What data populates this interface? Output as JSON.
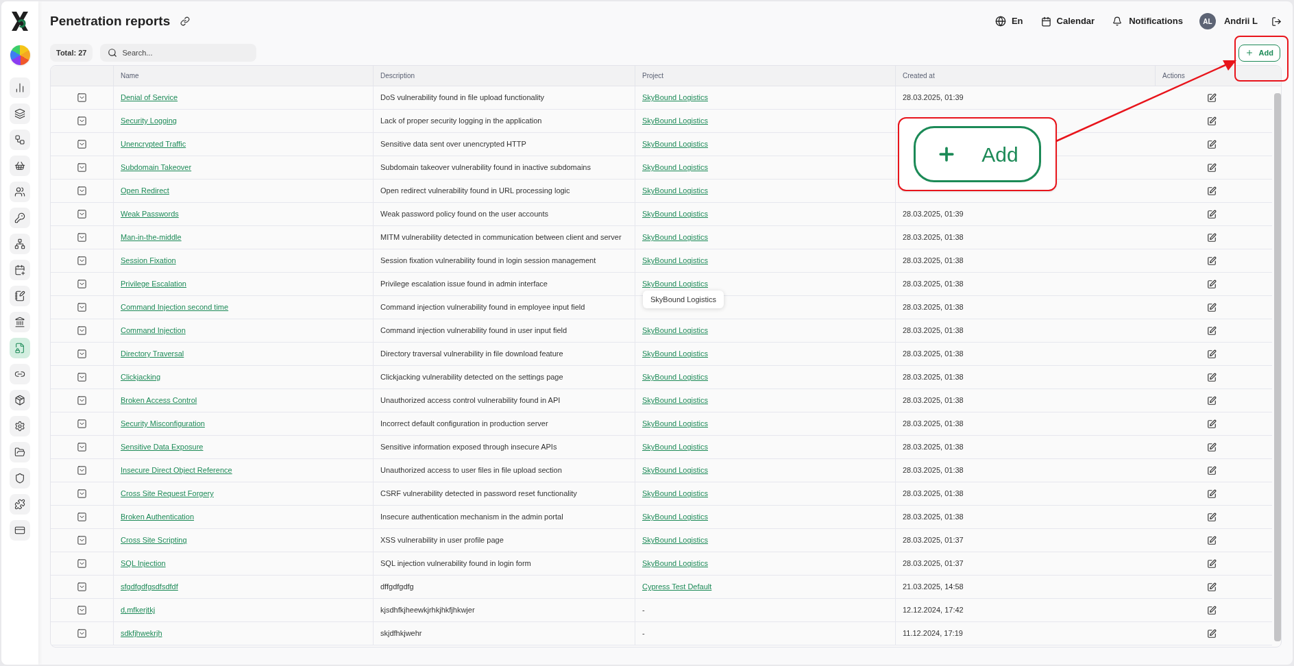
{
  "sidebar": {
    "items": [
      {
        "selected": false
      },
      {
        "selected": false
      },
      {
        "selected": false
      },
      {
        "selected": false
      },
      {
        "selected": false
      },
      {
        "selected": false
      },
      {
        "selected": false
      },
      {
        "selected": false
      },
      {
        "selected": false
      },
      {
        "selected": false
      },
      {
        "selected": true
      },
      {
        "selected": false
      },
      {
        "selected": false
      },
      {
        "selected": false
      },
      {
        "selected": false
      },
      {
        "selected": false
      },
      {
        "selected": false
      },
      {
        "selected": false
      }
    ]
  },
  "header": {
    "title": "Penetration reports",
    "language": "En",
    "calendar": "Calendar",
    "notifications": "Notifications",
    "avatar": "AL",
    "user": "Andrii L"
  },
  "toolbar": {
    "total": "Total: 27",
    "search": {
      "placeholder": "Search..."
    },
    "add_button": "Add"
  },
  "table": {
    "columns": [
      "Name",
      "Description",
      "Project",
      "Created at",
      "Actions"
    ],
    "rows": [
      {
        "name": "Denial of Service",
        "description": "DoS vulnerability found in file upload functionality",
        "project": "SkyBound Logistics",
        "created_at": "28.03.2025, 01:39"
      },
      {
        "name": "Security Logging",
        "description": "Lack of proper security logging in the application",
        "project": "SkyBound Logistics"
      },
      {
        "name": "Unencrypted Traffic",
        "description": "Sensitive data sent over unencrypted HTTP",
        "project": "SkyBound Logistics"
      },
      {
        "name": "Subdomain Takeover",
        "description": "Subdomain takeover vulnerability found in inactive subdomains",
        "project": "SkyBound Logistics"
      },
      {
        "name": "Open Redirect",
        "description": "Open redirect vulnerability found in URL processing logic",
        "project": "SkyBound Logistics"
      },
      {
        "name": "Weak Passwords",
        "description": "Weak password policy found on the user accounts",
        "project": "SkyBound Logistics",
        "created_at": "28.03.2025, 01:39"
      },
      {
        "name": "Man-in-the-middle",
        "description": "MITM vulnerability detected in communication between client and server",
        "project": "SkyBound Logistics",
        "created_at": "28.03.2025, 01:38"
      },
      {
        "name": "Session Fixation",
        "description": "Session fixation vulnerability found in login session management",
        "project": "SkyBound Logistics",
        "created_at": "28.03.2025, 01:38"
      },
      {
        "name": "Privilege Escalation",
        "description": "Privilege escalation issue found in admin interface",
        "project": "SkyBound Logistics",
        "created_at": "28.03.2025, 01:38"
      },
      {
        "name": "Command Injection second time",
        "description": "Command injection vulnerability found in employee input field",
        "tooltip": "SkyBound Logistics",
        "created_at": "28.03.2025, 01:38"
      },
      {
        "name": "Command Injection",
        "description": "Command injection vulnerability found in user input field",
        "project": "SkyBound Logistics",
        "created_at": "28.03.2025, 01:38"
      },
      {
        "name": "Directory Traversal",
        "description": "Directory traversal vulnerability in file download feature",
        "project": "SkyBound Logistics",
        "created_at": "28.03.2025, 01:38"
      },
      {
        "name": "Clickjacking",
        "description": "Clickjacking vulnerability detected on the settings page",
        "project": "SkyBound Logistics",
        "created_at": "28.03.2025, 01:38"
      },
      {
        "name": "Broken Access Control",
        "description": "Unauthorized access control vulnerability found in API",
        "project": "SkyBound Logistics",
        "created_at": "28.03.2025, 01:38"
      },
      {
        "name": "Security Misconfiguration",
        "description": "Incorrect default configuration in production server",
        "project": "SkyBound Logistics",
        "created_at": "28.03.2025, 01:38"
      },
      {
        "name": "Sensitive Data Exposure",
        "description": "Sensitive information exposed through insecure APIs",
        "project": "SkyBound Logistics",
        "created_at": "28.03.2025, 01:38"
      },
      {
        "name": "Insecure Direct Object Reference",
        "description": "Unauthorized access to user files in file upload section",
        "project": "SkyBound Logistics",
        "created_at": "28.03.2025, 01:38"
      },
      {
        "name": "Cross Site Request Forgery",
        "description": "CSRF vulnerability detected in password reset functionality",
        "project": "SkyBound Logistics",
        "created_at": "28.03.2025, 01:38"
      },
      {
        "name": "Broken Authentication",
        "description": "Insecure authentication mechanism in the admin portal",
        "project": "SkyBound Logistics",
        "created_at": "28.03.2025, 01:38"
      },
      {
        "name": "Cross Site Scripting",
        "description": "XSS vulnerability in user profile page",
        "project": "SkyBound Logistics",
        "created_at": "28.03.2025, 01:37"
      },
      {
        "name": "SQL Injection",
        "description": "SQL injection vulnerability found in login form",
        "project": "SkyBound Logistics",
        "created_at": "28.03.2025, 01:37"
      },
      {
        "name": "sfgdfgdfgsdfsdfdf",
        "description": "dffgdfgdfg",
        "project": "Cypress Test Default",
        "created_at": "21.03.2025, 14:58"
      },
      {
        "name": "d,mfkerjtkj",
        "description": "kjsdhfkjheewkjrhkjhkfjhkwjer",
        "project_empty": "-",
        "created_at": "12.12.2024, 17:42"
      },
      {
        "name": "sdkfjhwekrjh",
        "description": "skjdfhkjwehr",
        "project_empty": "-",
        "created_at": "11.12.2024, 17:19"
      }
    ]
  },
  "annotation": {
    "callout_label": "Add"
  }
}
